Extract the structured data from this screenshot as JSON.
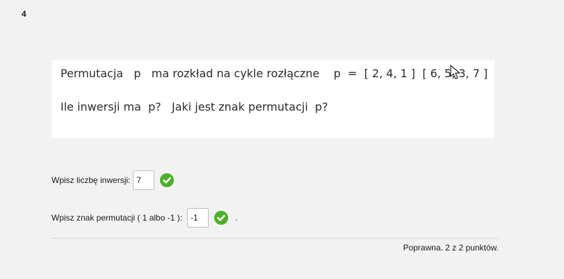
{
  "question": {
    "number": "4",
    "line1": "Permutacja   p   ma rozkład na cykle rozłączne    p  =  [ 2, 4, 1 ]  [ 6, 5, 3, 7 ]",
    "line2": "Ile inwersji ma  p?   Jaki jest znak permutacji  p?"
  },
  "answers": {
    "inversions_label": "Wpisz liczbę inwersji:",
    "inversions_value": "7",
    "sign_label": "Wpisz znak permutacji  ( 1 albo  -1 ):",
    "sign_value": "-1",
    "sign_suffix": "."
  },
  "feedback": {
    "grade": "Poprawna. 2 z 2 punktów.",
    "correct_color": "#4caf2a"
  }
}
